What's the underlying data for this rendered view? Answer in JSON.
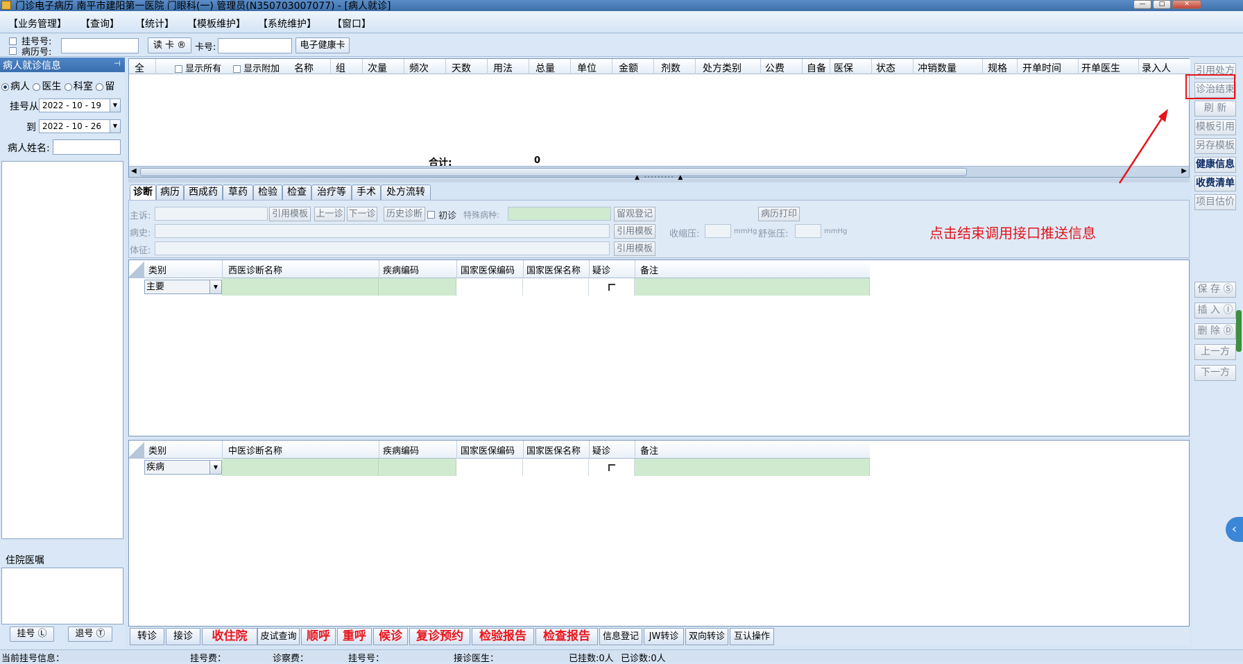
{
  "window": {
    "title": "门诊电子病历 南平市建阳第一医院 门眼科(一) 管理员(N350703007077) - [病人就诊]"
  },
  "menu": [
    "【业务管理】",
    "【查询】",
    "【统计】",
    "【模板维护】",
    "【系统维护】",
    "【窗口】"
  ],
  "toolbar": {
    "reg_no_label": "挂号号:",
    "record_no_label": "病历号:",
    "read_card_label": "读 卡 ®",
    "card_no_label": "卡号:",
    "health_card_label": "电子健康卡"
  },
  "left": {
    "header": "病人就诊信息",
    "pin_icon": "pin-icon",
    "radios": [
      {
        "label": "病人",
        "checked": true
      },
      {
        "label": "医生",
        "checked": false
      },
      {
        "label": "科室",
        "checked": false
      },
      {
        "label": "留",
        "checked": false
      }
    ],
    "from_label": "挂号从",
    "from_value": "2022 - 10 - 19",
    "to_label": "到",
    "to_value": "2022 - 10 - 26",
    "name_label": "病人姓名:",
    "name_value": "",
    "inpatient_label": "住院医嘱",
    "reg_btn": "挂号 Ⓛ",
    "unreg_btn": "退号 Ⓣ"
  },
  "rx": {
    "columns": [
      "全",
      "显示所有",
      "显示附加",
      "名称",
      "组",
      "次量",
      "频次",
      "天数",
      "用法",
      "总量",
      "单位",
      "金额",
      "剂数",
      "处方类别",
      "公费",
      "自备",
      "医保",
      "状态",
      "冲销数量",
      "规格",
      "开单时间",
      "开单医生",
      "录入人"
    ],
    "sum_label": "合计:",
    "sum_value": "0"
  },
  "tabs": [
    "诊断",
    "病历",
    "西成药",
    "草药",
    "检验",
    "检查",
    "治疗等",
    "手术",
    "处方流转"
  ],
  "diag_form": {
    "complaint_label": "主诉:",
    "history_label": "病史:",
    "signs_label": "体征:",
    "ref_template": "引用模板",
    "prev_visit": "上一诊",
    "next_visit": "下一诊",
    "history_diag": "历史诊断",
    "first_visit": "初诊",
    "special_disease": "特殊病种:",
    "observe_reg": "留观登记",
    "print_record": "病历打印",
    "systolic": "收缩压:",
    "diastolic": "舒张压:",
    "unit": "mmHg"
  },
  "west_grid": {
    "headers": [
      "类别",
      "西医诊断名称",
      "疾病编码",
      "国家医保编码",
      "国家医保名称",
      "疑诊",
      "备注"
    ],
    "row_type": "主要"
  },
  "tcm_grid": {
    "headers": [
      "类别",
      "中医诊断名称",
      "疾病编码",
      "国家医保编码",
      "国家医保名称",
      "疑诊",
      "备注"
    ],
    "row_type": "疾病"
  },
  "right_buttons": [
    {
      "label": "引用处方",
      "style": "gray"
    },
    {
      "label": "诊治结束",
      "style": "gray"
    },
    {
      "label": "刷  新",
      "style": "gray"
    },
    {
      "label": "模板引用",
      "style": "gray"
    },
    {
      "label": "另存模板",
      "style": "gray"
    },
    {
      "label": "健康信息",
      "style": "dark"
    },
    {
      "label": "收费清单",
      "style": "dark"
    },
    {
      "label": "项目估价",
      "style": "gray"
    },
    {
      "label": "保  存 Ⓢ",
      "style": "gray"
    },
    {
      "label": "插  入 Ⓘ",
      "style": "gray"
    },
    {
      "label": "删  除 Ⓓ",
      "style": "gray"
    },
    {
      "label": "上一方",
      "style": "gray"
    },
    {
      "label": "下一方",
      "style": "gray"
    }
  ],
  "annotation": "点击结束调用接口推送信息",
  "bottom_buttons": [
    {
      "label": "转诊",
      "red": false
    },
    {
      "label": "接诊",
      "red": false
    },
    {
      "label": "收住院",
      "red": true
    },
    {
      "label": "皮试查询",
      "red": false
    },
    {
      "label": "顺呼",
      "red": true
    },
    {
      "label": "重呼",
      "red": true
    },
    {
      "label": "候诊",
      "red": true
    },
    {
      "label": "复诊预约",
      "red": true
    },
    {
      "label": "检验报告",
      "red": true
    },
    {
      "label": "检查报告",
      "red": true
    },
    {
      "label": "信息登记",
      "red": false
    },
    {
      "label": "JW转诊",
      "red": false
    },
    {
      "label": "双向转诊",
      "red": false
    },
    {
      "label": "互认操作",
      "red": false
    }
  ],
  "status": {
    "current_reg": "当前挂号信息：",
    "reg_fee": "挂号费：",
    "diag_fee": "诊察费：",
    "reg_no": "挂号号：",
    "doctor": "接诊医生：",
    "registered": "已挂数:0人",
    "diagnosed": "已诊数:0人"
  },
  "colors": {
    "accent": "#3a6eae",
    "annotation": "#e3141a",
    "green_cell": "#cfeacf"
  }
}
